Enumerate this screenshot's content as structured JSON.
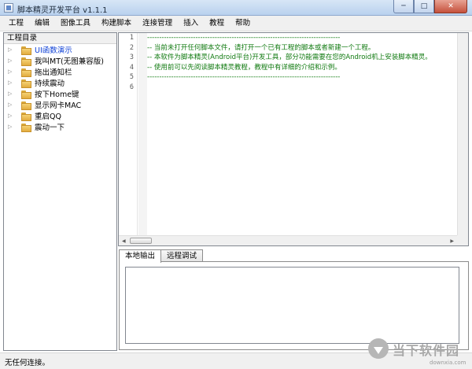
{
  "window": {
    "title": "脚本精灵开发平台 v1.1.1",
    "minimize_glyph": "─",
    "maximize_glyph": "□",
    "close_glyph": "✕"
  },
  "menu": [
    "工程",
    "编辑",
    "图像工具",
    "构建脚本",
    "连接管理",
    "插入",
    "教程",
    "帮助"
  ],
  "project_pane": {
    "title": "工程目录",
    "items": [
      {
        "label": "UI函数演示",
        "selected": true
      },
      {
        "label": "我叫MT(无图兼容版)",
        "selected": false
      },
      {
        "label": "拖出通知栏",
        "selected": false
      },
      {
        "label": "持续震动",
        "selected": false
      },
      {
        "label": "按下Home键",
        "selected": false
      },
      {
        "label": "显示网卡MAC",
        "selected": false
      },
      {
        "label": "重启QQ",
        "selected": false
      },
      {
        "label": "震动一下",
        "selected": false
      }
    ]
  },
  "editor": {
    "line_numbers": [
      "1",
      "2",
      "3",
      "4",
      "5",
      "6"
    ],
    "lines": [
      "--------------------------------------------------------------------------------",
      "-- 当前未打开任何脚本文件，请打开一个已有工程的脚本或者新建一个工程。",
      "-- 本软件为脚本精灵(Android平台)开发工具，部分功能需要在您的Android机上安装脚本精灵。",
      "-- 使用前可以先阅读脚本精灵教程，教程中有详细的介绍和示例。",
      "--------------------------------------------------------------------------------",
      ""
    ]
  },
  "output": {
    "tabs": [
      {
        "label": "本地输出",
        "active": true
      },
      {
        "label": "远程调试",
        "active": false
      }
    ]
  },
  "status": {
    "text": "无任何连接。"
  },
  "watermark": {
    "text": "当下软件园",
    "url": "downxia.com"
  }
}
